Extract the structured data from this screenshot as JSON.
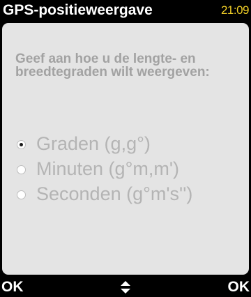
{
  "title_bar": {
    "title": "GPS-positieweergave",
    "clock": "21:09"
  },
  "prompt": "Geef aan hoe u de lengte- en breedtegraden wilt weergeven:",
  "options": [
    {
      "label": "Graden (g,g°)",
      "selected": true
    },
    {
      "label": "Minuten (g°m,m')",
      "selected": false
    },
    {
      "label": "Seconden (g°m's'')",
      "selected": false
    }
  ],
  "softkeys": {
    "left": "OK",
    "center_icon": "up-down-arrows-icon",
    "right": "OK"
  },
  "colors": {
    "background": "#000000",
    "panel": "#e4e4e4",
    "clock": "#f2d027",
    "prompt_text": "#a2a2a2",
    "option_text": "#b4b4b4"
  }
}
